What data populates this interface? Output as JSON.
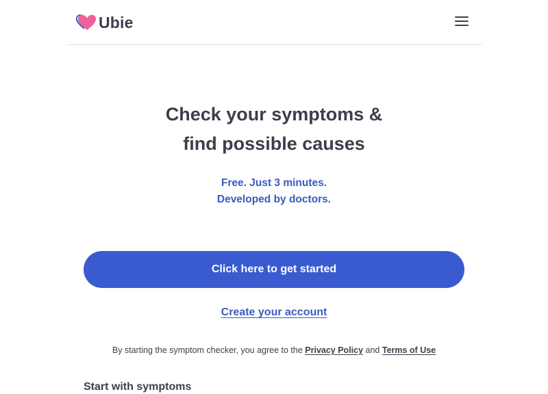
{
  "header": {
    "logo_text": "Ubie",
    "menu_icon": "hamburger-menu-icon",
    "logo_icon": "heart-logo-icon"
  },
  "hero": {
    "title_line1": "Check your symptoms &",
    "title_line2": "find possible causes",
    "subtitle_line1": "Free. Just 3 minutes.",
    "subtitle_line2": "Developed by doctors."
  },
  "actions": {
    "start_label": "Click here to get started",
    "create_account_label": "Create your account"
  },
  "agreement": {
    "prefix": "By starting the symptom checker, you agree to the ",
    "privacy_label": "Privacy Policy",
    "conjunction": " and ",
    "terms_label": "Terms of Use"
  },
  "sections": {
    "start_with_symptoms": "Start with symptoms"
  },
  "colors": {
    "primary": "#3a5bd0",
    "accent_text": "#3a5cbf",
    "heart_pink": "#f0609a",
    "heart_blue": "#3a5bd0",
    "text": "#3b3f4a"
  }
}
